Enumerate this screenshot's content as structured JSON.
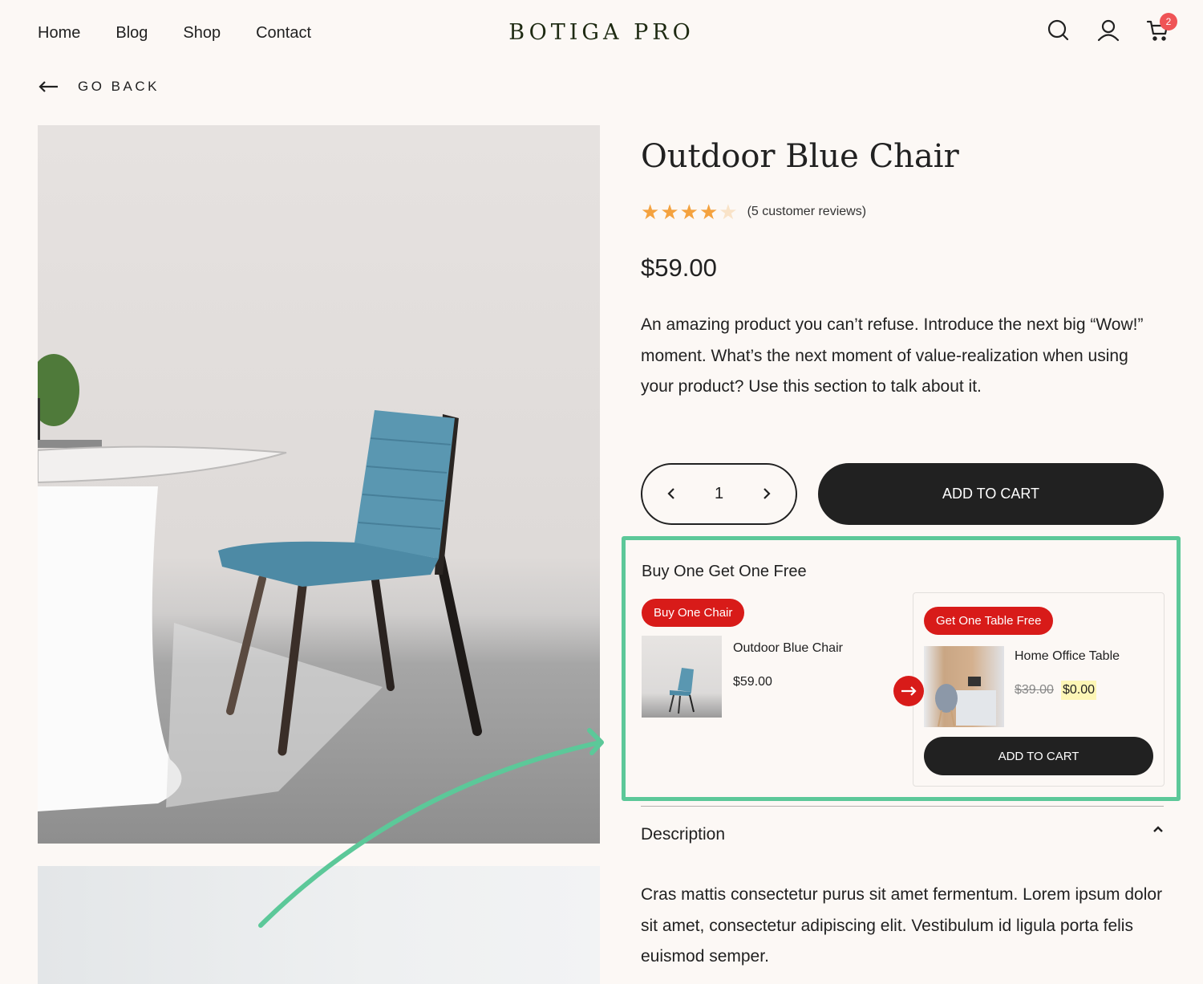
{
  "header": {
    "nav": [
      "Home",
      "Blog",
      "Shop",
      "Contact"
    ],
    "logo": "BOTIGA PRO",
    "icons": [
      "search-icon",
      "user-icon",
      "cart-icon"
    ],
    "cart_count": "2"
  },
  "go_back": {
    "label": "GO BACK",
    "icon": "arrow-left-icon"
  },
  "product": {
    "title": "Outdoor Blue Chair",
    "rating": {
      "value": 4,
      "max": 5,
      "label": "(5 customer reviews)"
    },
    "price": "$59.00",
    "short_description": "An amazing product you can’t refuse. Introduce the next big “Wow!” moment. What’s the next moment of value-realization when using your product? Use this section to talk about it.",
    "quantity": "1",
    "add_to_cart": "ADD TO CART"
  },
  "bogo": {
    "title": "Buy One Get One Free",
    "buy": {
      "badge": "Buy One Chair",
      "name": "Outdoor Blue Chair",
      "price": "$59.00"
    },
    "get": {
      "badge": "Get One Table Free",
      "name": "Home Office Table",
      "old_price": "$39.00",
      "new_price": "$0.00",
      "add_to_cart": "ADD TO CART"
    }
  },
  "description": {
    "title": "Description",
    "body": "Cras mattis consectetur purus sit amet fermentum. Lorem ipsum dolor sit amet, consectetur adipiscing elit. Vestibulum id ligula porta felis euismod semper."
  },
  "colors": {
    "accent_green": "#5cc899",
    "badge_red": "#d81b19",
    "cart_badge": "#ef5456",
    "star": "#f4a23f",
    "star_empty": "#f9e3c8",
    "dark": "#212121",
    "highlight": "#fdf6b6"
  }
}
